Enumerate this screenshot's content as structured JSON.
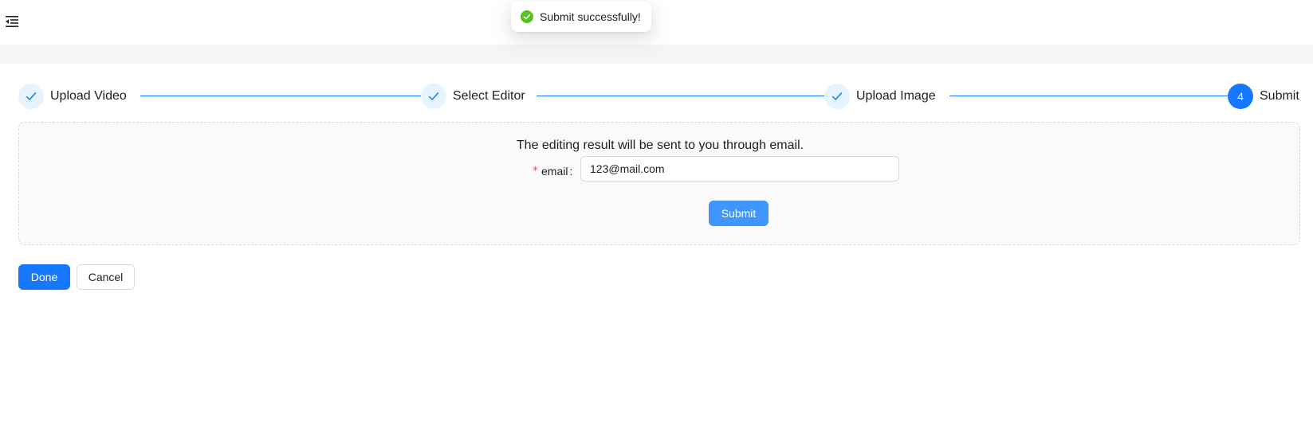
{
  "header": {
    "menu_icon": "menu-fold-icon"
  },
  "toast": {
    "message": "Submit successfully!",
    "icon": "check-circle-icon",
    "color": "#52c41a"
  },
  "steps": [
    {
      "title": "Upload Video",
      "status": "finished"
    },
    {
      "title": "Select Editor",
      "status": "finished"
    },
    {
      "title": "Upload Image",
      "status": "finished"
    },
    {
      "title": "Submit",
      "status": "current",
      "number": "4"
    }
  ],
  "form": {
    "notice": "The editing result will be sent to you through email.",
    "required_mark": "*",
    "email_label": "email",
    "email_colon": ":",
    "email_value": "123@mail.com",
    "submit_label": "Submit"
  },
  "footer": {
    "done_label": "Done",
    "cancel_label": "Cancel"
  },
  "colors": {
    "primary": "#1677ff",
    "submit_hover": "#4096ff",
    "required": "#ff4d4f"
  }
}
